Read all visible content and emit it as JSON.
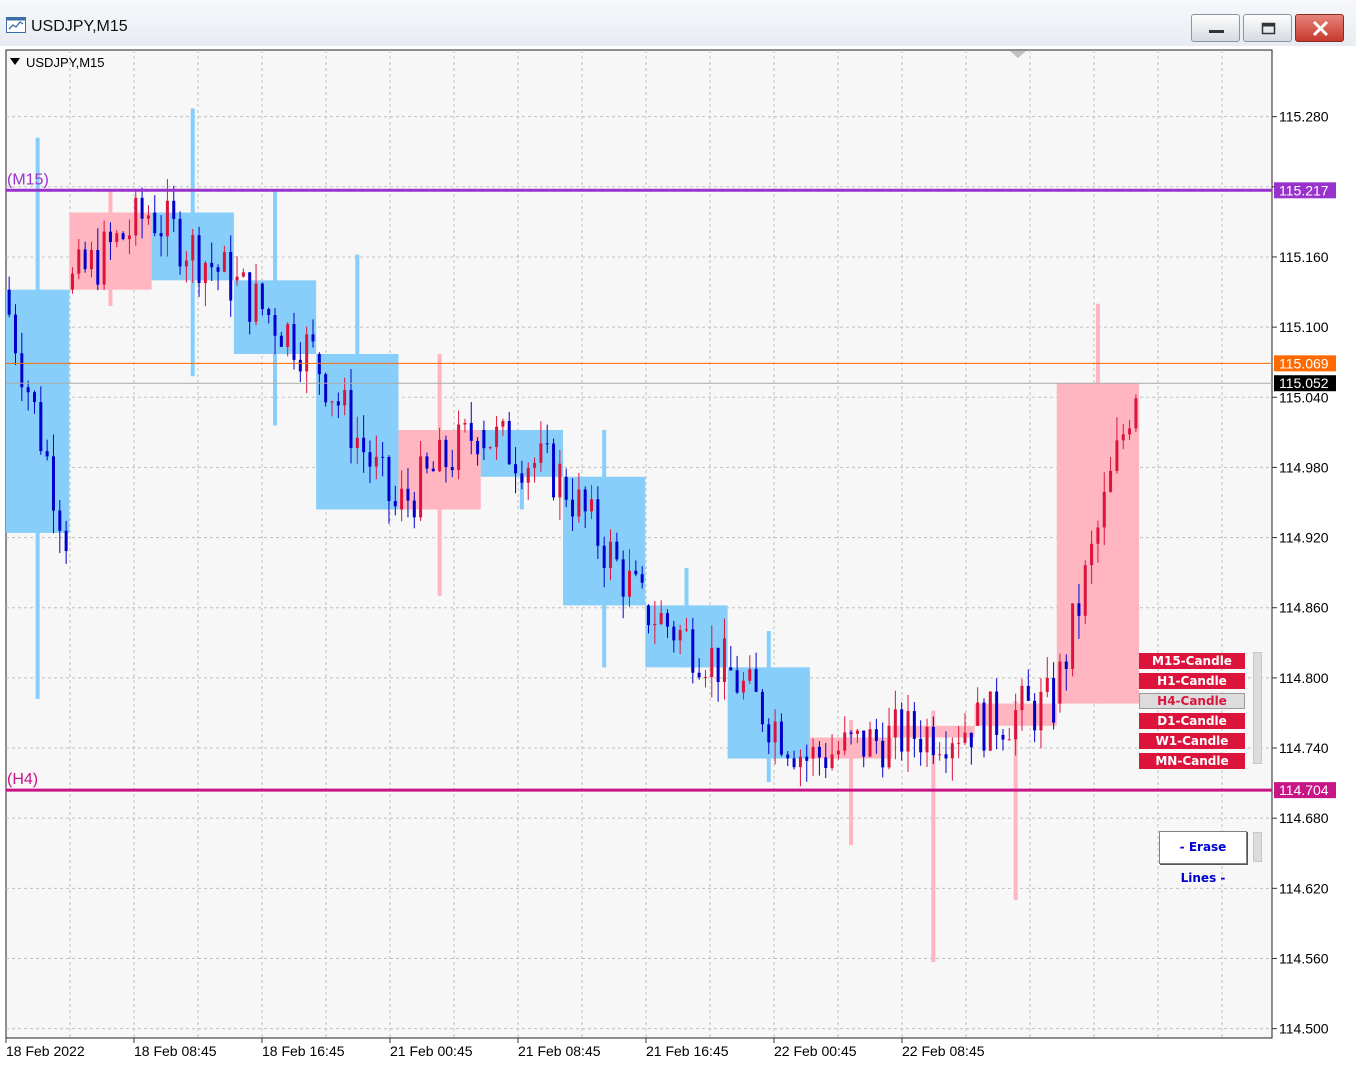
{
  "window": {
    "title": "USDJPY,M15"
  },
  "chart_label": "USDJPY,M15",
  "price_labels": [
    "115.280",
    "115.160",
    "115.100",
    "115.040",
    "114.980",
    "114.920",
    "114.860",
    "114.800",
    "114.740",
    "114.680",
    "114.620",
    "114.560",
    "114.500"
  ],
  "time_labels": [
    "18 Feb 2022",
    "18 Feb 08:45",
    "18 Feb 16:45",
    "21 Feb 00:45",
    "21 Feb 08:45",
    "21 Feb 16:45",
    "22 Feb 00:45",
    "22 Feb 08:45"
  ],
  "lines": {
    "m15": {
      "label": "(M15)",
      "price": "115.217",
      "color": "#9932cc"
    },
    "h4": {
      "label": "(H4)",
      "price": "114.704",
      "color": "#c71585"
    },
    "ask": {
      "price": "115.069",
      "color": "#ff6a00"
    },
    "bid": {
      "price": "115.052",
      "color": "#000000"
    }
  },
  "colors": {
    "bull": "#dc143c",
    "bear": "#0000cd",
    "box_bull": "#ffb6c1",
    "box_bear": "#87cefa",
    "background": "#f7f7f7",
    "grid": "#c0c0c0"
  },
  "buttons": {
    "m15": "M15-Candle",
    "h1": "H1-Candle",
    "h4": "H4-Candle",
    "d1": "D1-Candle",
    "w1": "W1-Candle",
    "mn": "MN-Candle",
    "erase": "- Erase Lines -"
  },
  "chart_data": {
    "type": "candlestick",
    "y_range": [
      114.492,
      115.337
    ],
    "boxes": [
      {
        "x0": 0,
        "x1": 10,
        "o": 115.132,
        "c": 114.924,
        "h": 115.262,
        "l": 114.782
      },
      {
        "x0": 10,
        "x1": 23,
        "o": 115.132,
        "c": 115.198,
        "h": 115.217,
        "l": 115.118
      },
      {
        "x0": 23,
        "x1": 36,
        "o": 115.198,
        "c": 115.14,
        "h": 115.287,
        "l": 115.058
      },
      {
        "x0": 36,
        "x1": 49,
        "o": 115.14,
        "c": 115.077,
        "h": 115.217,
        "l": 115.016
      },
      {
        "x0": 49,
        "x1": 62,
        "o": 115.077,
        "c": 114.944,
        "h": 115.162,
        "l": 114.97
      },
      {
        "x0": 62,
        "x1": 75,
        "o": 114.944,
        "c": 115.012,
        "h": 115.077,
        "l": 114.87
      },
      {
        "x0": 75,
        "x1": 88,
        "o": 115.012,
        "c": 114.972,
        "h": 115.012,
        "l": 114.944
      },
      {
        "x0": 88,
        "x1": 101,
        "o": 114.972,
        "c": 114.862,
        "h": 115.012,
        "l": 114.809
      },
      {
        "x0": 101,
        "x1": 114,
        "o": 114.862,
        "c": 114.809,
        "h": 114.894,
        "l": 114.809
      },
      {
        "x0": 114,
        "x1": 127,
        "o": 114.809,
        "c": 114.731,
        "h": 114.84,
        "l": 114.711
      },
      {
        "x0": 127,
        "x1": 140,
        "o": 114.731,
        "c": 114.749,
        "h": 114.764,
        "l": 114.657
      },
      {
        "x0": 140,
        "x1": 153,
        "o": 114.749,
        "c": 114.759,
        "h": 114.772,
        "l": 114.557
      },
      {
        "x0": 153,
        "x1": 166,
        "o": 114.759,
        "c": 114.778,
        "h": 114.78,
        "l": 114.61
      },
      {
        "x0": 166,
        "x1": 179,
        "o": 114.778,
        "c": 115.052,
        "h": 115.12,
        "l": 114.778
      }
    ]
  }
}
